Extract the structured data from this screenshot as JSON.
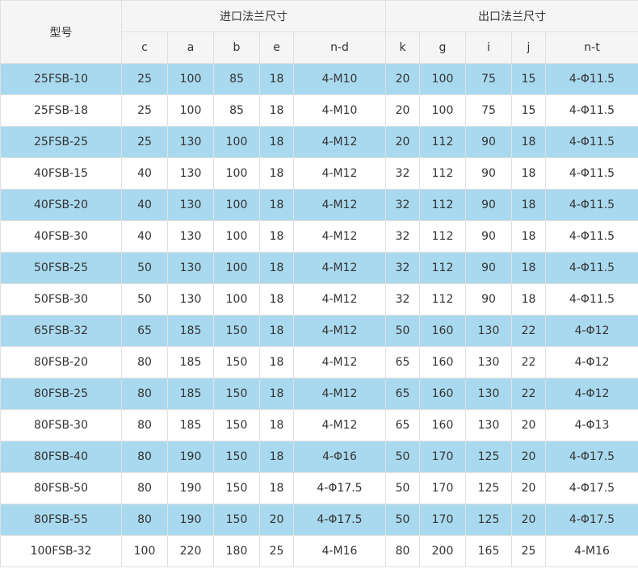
{
  "header": {
    "model_label": "型号",
    "inlet_group": "进口法兰尺寸",
    "outlet_group": "出口法兰尺寸",
    "columns": [
      "c",
      "a",
      "b",
      "e",
      "n-d",
      "k",
      "g",
      "i",
      "j",
      "n-t"
    ]
  },
  "rows": [
    [
      "25FSB-10",
      "25",
      "100",
      "85",
      "18",
      "4-M10",
      "20",
      "100",
      "75",
      "15",
      "4-Φ11.5"
    ],
    [
      "25FSB-18",
      "25",
      "100",
      "85",
      "18",
      "4-M10",
      "20",
      "100",
      "75",
      "15",
      "4-Φ11.5"
    ],
    [
      "25FSB-25",
      "25",
      "130",
      "100",
      "18",
      "4-M12",
      "20",
      "112",
      "90",
      "18",
      "4-Φ11.5"
    ],
    [
      "40FSB-15",
      "40",
      "130",
      "100",
      "18",
      "4-M12",
      "32",
      "112",
      "90",
      "18",
      "4-Φ11.5"
    ],
    [
      "40FSB-20",
      "40",
      "130",
      "100",
      "18",
      "4-M12",
      "32",
      "112",
      "90",
      "18",
      "4-Φ11.5"
    ],
    [
      "40FSB-30",
      "40",
      "130",
      "100",
      "18",
      "4-M12",
      "32",
      "112",
      "90",
      "18",
      "4-Φ11.5"
    ],
    [
      "50FSB-25",
      "50",
      "130",
      "100",
      "18",
      "4-M12",
      "32",
      "112",
      "90",
      "18",
      "4-Φ11.5"
    ],
    [
      "50FSB-30",
      "50",
      "130",
      "100",
      "18",
      "4-M12",
      "32",
      "112",
      "90",
      "18",
      "4-Φ11.5"
    ],
    [
      "65FSB-32",
      "65",
      "185",
      "150",
      "18",
      "4-M12",
      "50",
      "160",
      "130",
      "22",
      "4-Φ12"
    ],
    [
      "80FSB-20",
      "80",
      "185",
      "150",
      "18",
      "4-M12",
      "65",
      "160",
      "130",
      "22",
      "4-Φ12"
    ],
    [
      "80FSB-25",
      "80",
      "185",
      "150",
      "18",
      "4-M12",
      "65",
      "160",
      "130",
      "22",
      "4-Φ12"
    ],
    [
      "80FSB-30",
      "80",
      "185",
      "150",
      "18",
      "4-M12",
      "65",
      "160",
      "130",
      "20",
      "4-Φ13"
    ],
    [
      "80FSB-40",
      "80",
      "190",
      "150",
      "18",
      "4-Φ16",
      "50",
      "170",
      "125",
      "20",
      "4-Φ17.5"
    ],
    [
      "80FSB-50",
      "80",
      "190",
      "150",
      "18",
      "4-Φ17.5",
      "50",
      "170",
      "125",
      "20",
      "4-Φ17.5"
    ],
    [
      "80FSB-55",
      "80",
      "190",
      "150",
      "20",
      "4-Φ17.5",
      "50",
      "170",
      "125",
      "20",
      "4-Φ17.5"
    ],
    [
      "100FSB-32",
      "100",
      "220",
      "180",
      "25",
      "4-M16",
      "80",
      "200",
      "165",
      "25",
      "4-M16"
    ]
  ],
  "colors": {
    "row_highlight": "#a9d9ee",
    "header_bg": "#f5f5f5",
    "border": "#e0e0e0",
    "text": "#333333"
  }
}
